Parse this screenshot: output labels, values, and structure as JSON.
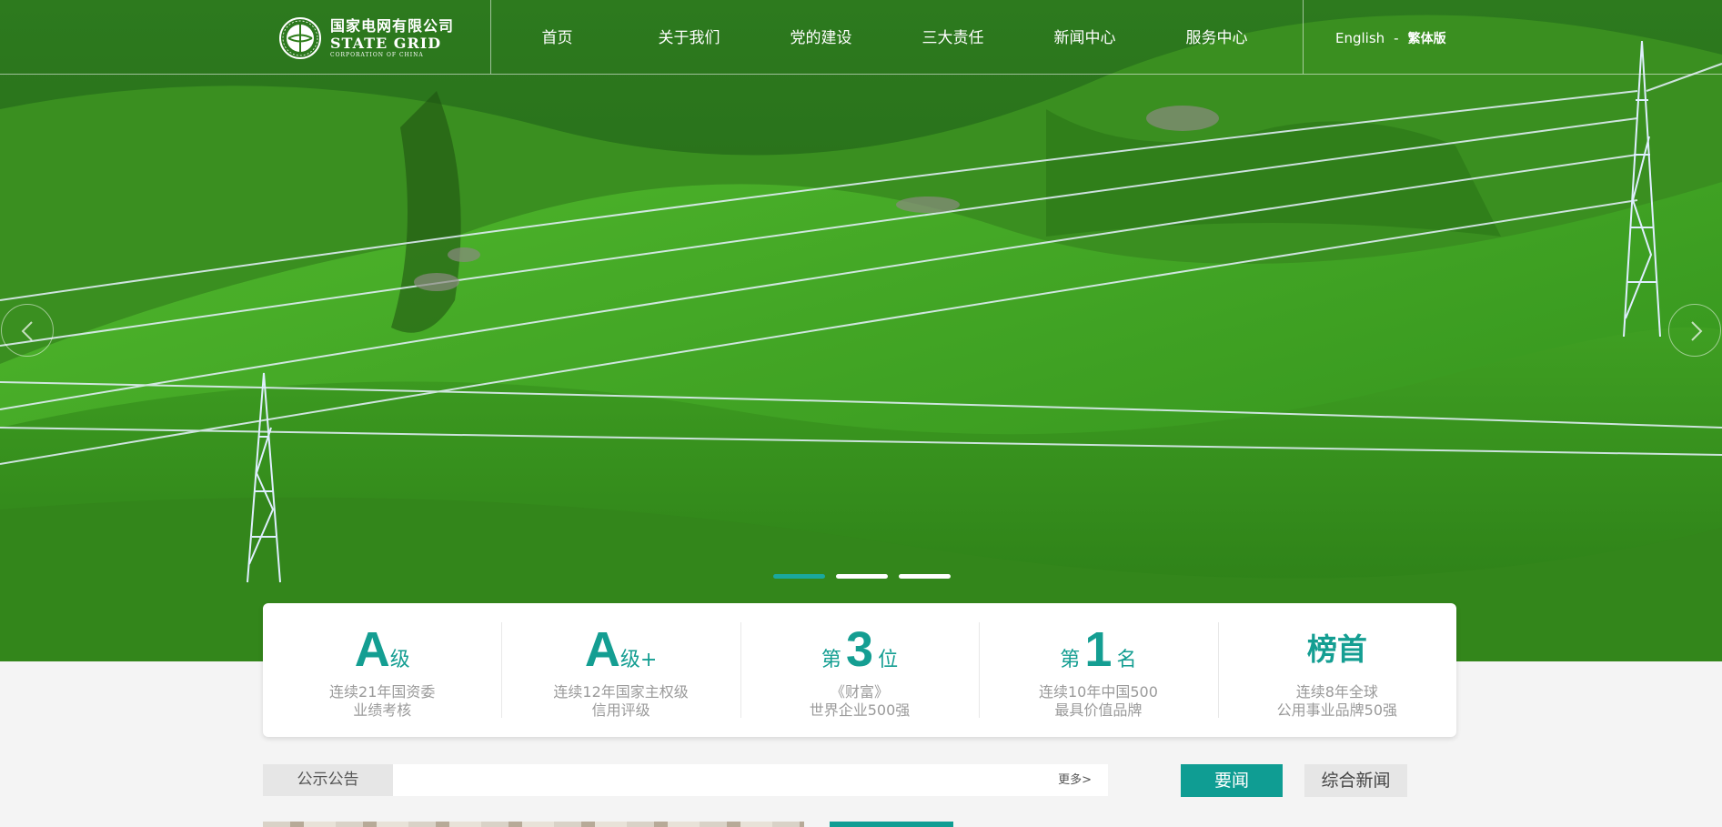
{
  "header": {
    "logo": {
      "name_cn": "国家电网有限公司",
      "name_en": "State Grid",
      "subtitle_en": "CORPORATION OF CHINA"
    },
    "nav": [
      {
        "label": "首页"
      },
      {
        "label": "关于我们"
      },
      {
        "label": "党的建设"
      },
      {
        "label": "三大责任"
      },
      {
        "label": "新闻中心"
      },
      {
        "label": "服务中心"
      }
    ],
    "lang": {
      "english": "English",
      "separator": "-",
      "traditional": "繁体版"
    }
  },
  "carousel": {
    "slide_count": 3,
    "active_index": 0,
    "icons": {
      "prev": "chevron-left-icon",
      "next": "chevron-right-icon"
    }
  },
  "stats": [
    {
      "prefix": "",
      "big": "A",
      "suffix": "级",
      "line1": "连续21年国资委",
      "line2": "业绩考核"
    },
    {
      "prefix": "",
      "big": "A",
      "suffix": "级+",
      "line1": "连续12年国家主权级",
      "line2": "信用评级"
    },
    {
      "prefix": "第",
      "big": "3",
      "suffix": "位",
      "line1": "《财富》",
      "line2": "世界企业500强"
    },
    {
      "prefix": "第",
      "big": "1",
      "suffix": "名",
      "line1": "连续10年中国500",
      "line2": "最具价值品牌"
    },
    {
      "prefix": "",
      "big": "榜首",
      "suffix": "",
      "line1": "连续8年全球",
      "line2": "公用事业品牌50强"
    }
  ],
  "notice": {
    "label": "公示公告",
    "more": "更多>"
  },
  "news_tabs": [
    {
      "label": "要闻",
      "active": true
    },
    {
      "label": "综合新闻",
      "active": false
    }
  ],
  "colors": {
    "accent": "#0f9d93",
    "stat_text": "#149e92",
    "stat_desc": "#9a9a9a"
  }
}
